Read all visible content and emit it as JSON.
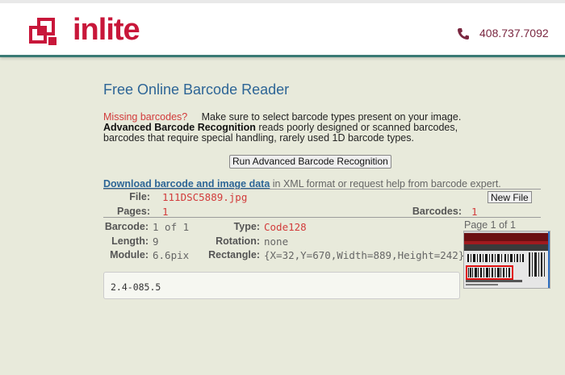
{
  "header": {
    "logo_text": "inlite",
    "phone": "408.737.7092",
    "brand_color": "#c8173a",
    "accent_color": "#3a7a74"
  },
  "page": {
    "title": "Free Online Barcode Reader"
  },
  "info": {
    "missing_label": "Missing barcodes?",
    "missing_text": "Make sure to select barcode types present on your image.",
    "abr_label": "Advanced Barcode Recognition",
    "abr_text": " reads poorly designed or scanned barcodes,",
    "abr_text2": "barcodes that require special handling, rarely used 1D barcode types."
  },
  "run_button": "Run Advanced Barcode Recognition",
  "download": {
    "link": "Download barcode and image data",
    "text": " in XML format or request help from barcode expert."
  },
  "file": {
    "file_label": "File:",
    "file_value": "111DSC5889.jpg",
    "new_file_button": "New File",
    "pages_label": "Pages:",
    "pages_value": "1",
    "barcodes_label": "Barcodes:",
    "barcodes_value": "1"
  },
  "barcode": {
    "barcode_label": "Barcode:",
    "barcode_value": "1 of 1",
    "type_label": "Type:",
    "type_value": "Code128",
    "length_label": "Length:",
    "length_value": "9",
    "rotation_label": "Rotation:",
    "rotation_value": "none",
    "module_label": "Module:",
    "module_value": "6.6pix",
    "rectangle_label": "Rectangle:",
    "rectangle_value": "{X=32,Y=670,Width=889,Height=242}"
  },
  "preview": {
    "page_of": "Page 1 of 1"
  },
  "result_text": "2.4-085.5"
}
